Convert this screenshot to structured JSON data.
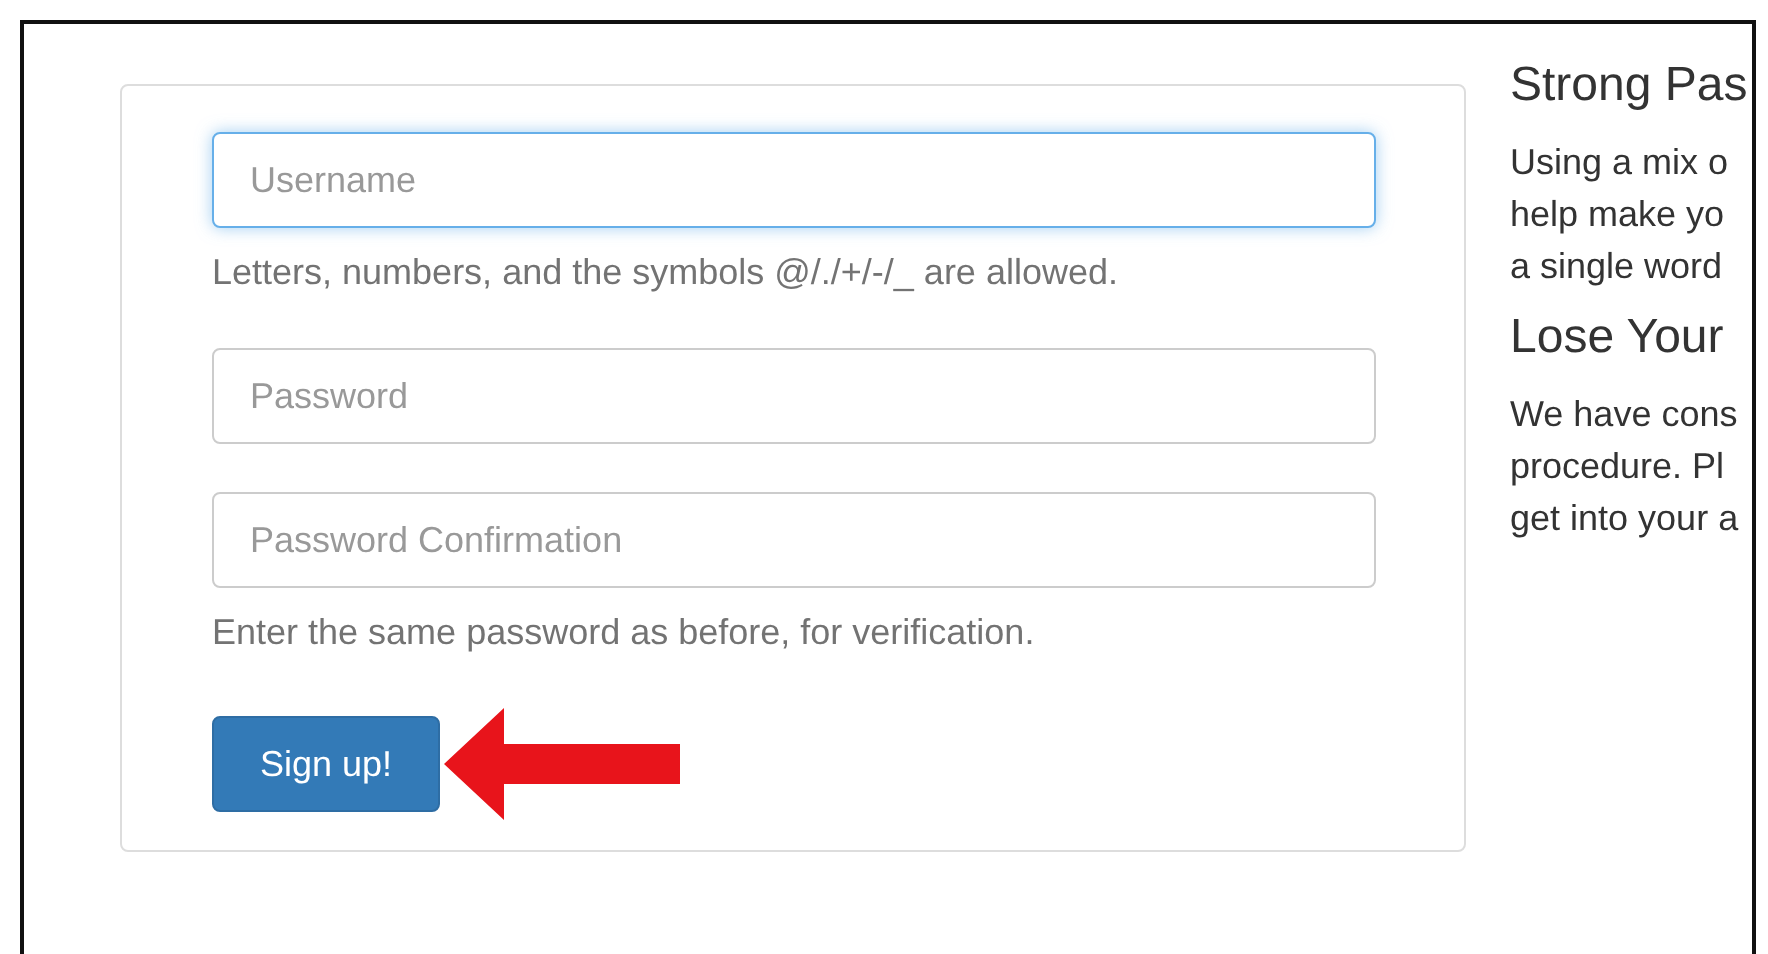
{
  "form": {
    "fields": [
      {
        "placeholder": "Username",
        "focused": true,
        "help": "Letters, numbers, and the symbols @/./+/-/_ are allowed."
      },
      {
        "placeholder": "Password",
        "focused": false
      },
      {
        "placeholder": "Password Confirmation",
        "focused": false,
        "help": "Enter the same password as before, for verification."
      }
    ],
    "submit": {
      "label": "Sign up!"
    }
  },
  "sidebar": [
    {
      "heading": "Strong Pas",
      "lines": [
        "Using a mix o",
        "help make yo",
        "a single word"
      ]
    },
    {
      "heading": "Lose Your",
      "lines": [
        "We have cons",
        "procedure. Pl",
        "get into your a"
      ]
    }
  ]
}
